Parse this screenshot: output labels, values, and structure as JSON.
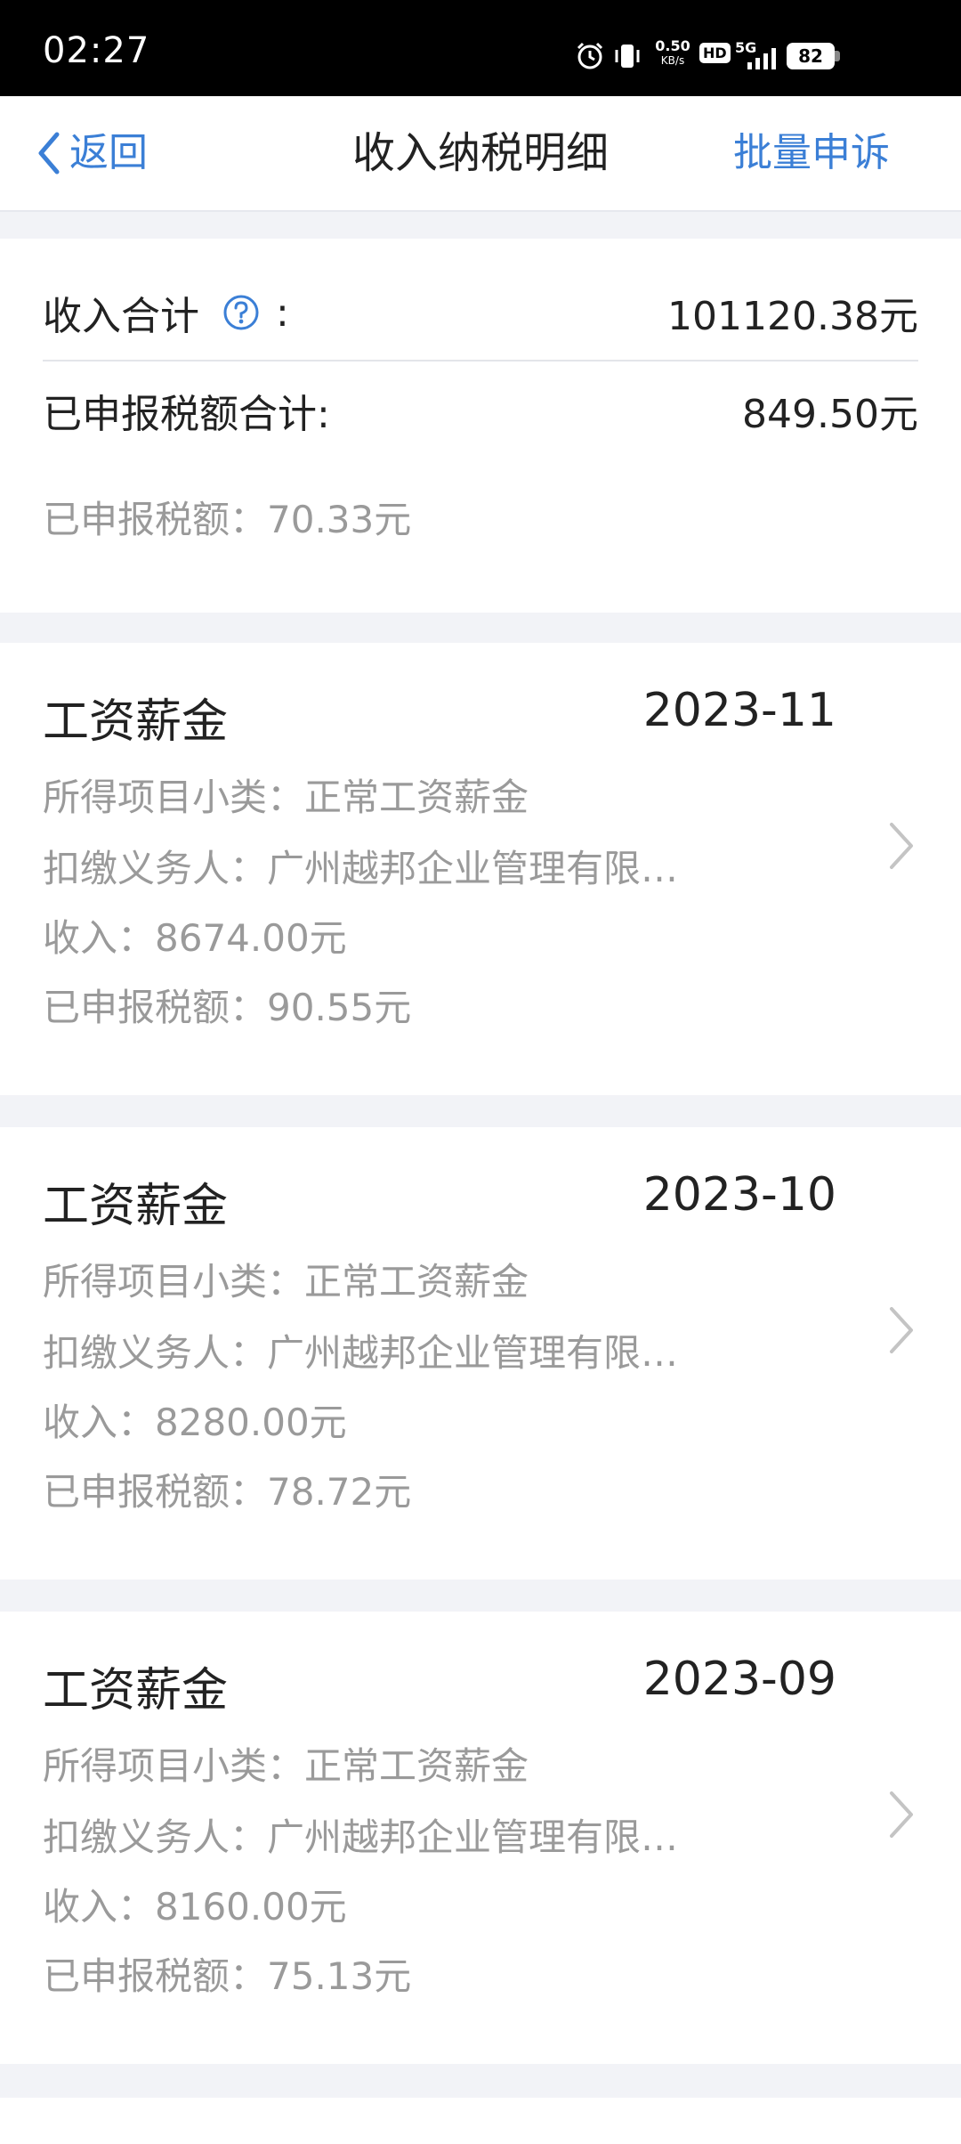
{
  "status_bar": {
    "time": "02:27",
    "speed": "0.50",
    "speed_unit": "KB/s",
    "hd": "HD",
    "network": "5G",
    "battery": "82",
    "icons": [
      "alarm-icon",
      "vibrate-icon",
      "signal-icon"
    ]
  },
  "nav": {
    "back_label": "返回",
    "title": "收入纳税明细",
    "action_label": "批量申诉"
  },
  "summary": {
    "income_total_label": "收入合计",
    "income_total_colon": ":",
    "income_total_value": "101120.38元",
    "tax_total_label": "已申报税额合计:",
    "tax_total_value": "849.50元",
    "extra_tax_line": "已申报税额：70.33元"
  },
  "records": [
    {
      "category": "工资薪金",
      "period": "2023-11",
      "subcategory_line": "所得项目小类：正常工资薪金",
      "withholder_line": "扣缴义务人：广州越邦企业管理有限…",
      "income_line": "收入：8674.00元",
      "tax_line": "已申报税额：90.55元"
    },
    {
      "category": "工资薪金",
      "period": "2023-10",
      "subcategory_line": "所得项目小类：正常工资薪金",
      "withholder_line": "扣缴义务人：广州越邦企业管理有限…",
      "income_line": "收入：8280.00元",
      "tax_line": "已申报税额：78.72元"
    },
    {
      "category": "工资薪金",
      "period": "2023-09",
      "subcategory_line": "所得项目小类：正常工资薪金",
      "withholder_line": "扣缴义务人：广州越邦企业管理有限…",
      "income_line": "收入：8160.00元",
      "tax_line": "已申报税额：75.13元"
    }
  ],
  "colors": {
    "accent": "#3b7fd6",
    "page_bg": "#f2f3f7",
    "secondary_text": "#9a9a9a"
  }
}
